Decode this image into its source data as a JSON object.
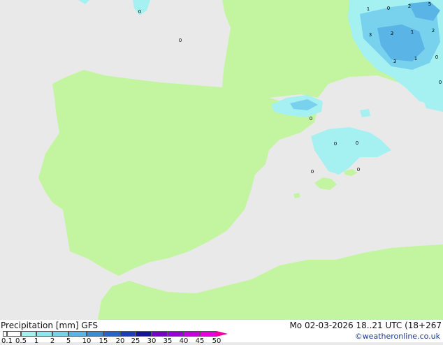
{
  "map": {
    "land_color": "#c3f5a0",
    "sea_color": "#e9e9e9",
    "precip_labels": [
      "0",
      "0",
      "1",
      "0",
      "2",
      "5",
      "3",
      "3",
      "1",
      "2",
      "3",
      "1",
      "0",
      "0",
      "0",
      "0",
      "0",
      "0",
      "0"
    ]
  },
  "footer": {
    "title": "Precipitation [mm]",
    "model": "GFS",
    "forecast_info": "Mo 02-03-2026 18..21 UTC (18+267",
    "credit": "©weatheronline.co.uk"
  },
  "scale": {
    "ticks": [
      "0.1",
      "0.5",
      "1",
      "2",
      "5",
      "10",
      "15",
      "20",
      "25",
      "30",
      "35",
      "40",
      "45",
      "50"
    ],
    "colors": [
      "#fefefe",
      "#a5f0f0",
      "#8ce6f0",
      "#78d2ee",
      "#5ab4e6",
      "#3c8cd2",
      "#2864c8",
      "#1e3cb4",
      "#141496",
      "#7800c8",
      "#9600dc",
      "#c800dc",
      "#e600dc",
      "#f000a0"
    ]
  }
}
